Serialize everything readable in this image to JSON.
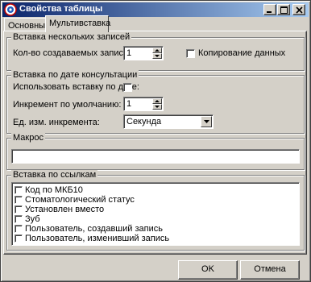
{
  "window": {
    "title": "Свойства таблицы",
    "icons": {
      "app": "app-logo-icon",
      "minimize": "minimize-icon",
      "maximize": "maximize-icon",
      "close": "close-icon"
    }
  },
  "tabs": [
    {
      "label": "Основные",
      "active": false
    },
    {
      "label": "Мультивставка",
      "active": true
    }
  ],
  "multi_insert": {
    "group_title": "Вставка нескольких записей",
    "count_label": "Кол-во создаваемых записей:",
    "count_value": "1",
    "copy_data_label": "Копирование данных",
    "copy_data_checked": false
  },
  "date_insert": {
    "group_title": "Вставка по дате консультации",
    "use_date_label": "Использовать вставку по дате:",
    "use_date_checked": false,
    "increment_label": "Инкремент по умолчанию:",
    "increment_value": "1",
    "unit_label": "Ед. изм. инкремента:",
    "unit_value": "Секунда"
  },
  "macro": {
    "group_title": "Макрос",
    "value": ""
  },
  "link_insert": {
    "group_title": "Вставка по ссылкам",
    "items": [
      {
        "label": "Код по МКБ10",
        "checked": false
      },
      {
        "label": "Стоматологический статус",
        "checked": false
      },
      {
        "label": "Установлен вместо",
        "checked": false
      },
      {
        "label": "Зуб",
        "checked": false
      },
      {
        "label": "Пользователь, создавший запись",
        "checked": false
      },
      {
        "label": "Пользователь, изменивший запись",
        "checked": false
      }
    ]
  },
  "footer": {
    "ok_label": "OK",
    "cancel_label": "Отмена"
  }
}
